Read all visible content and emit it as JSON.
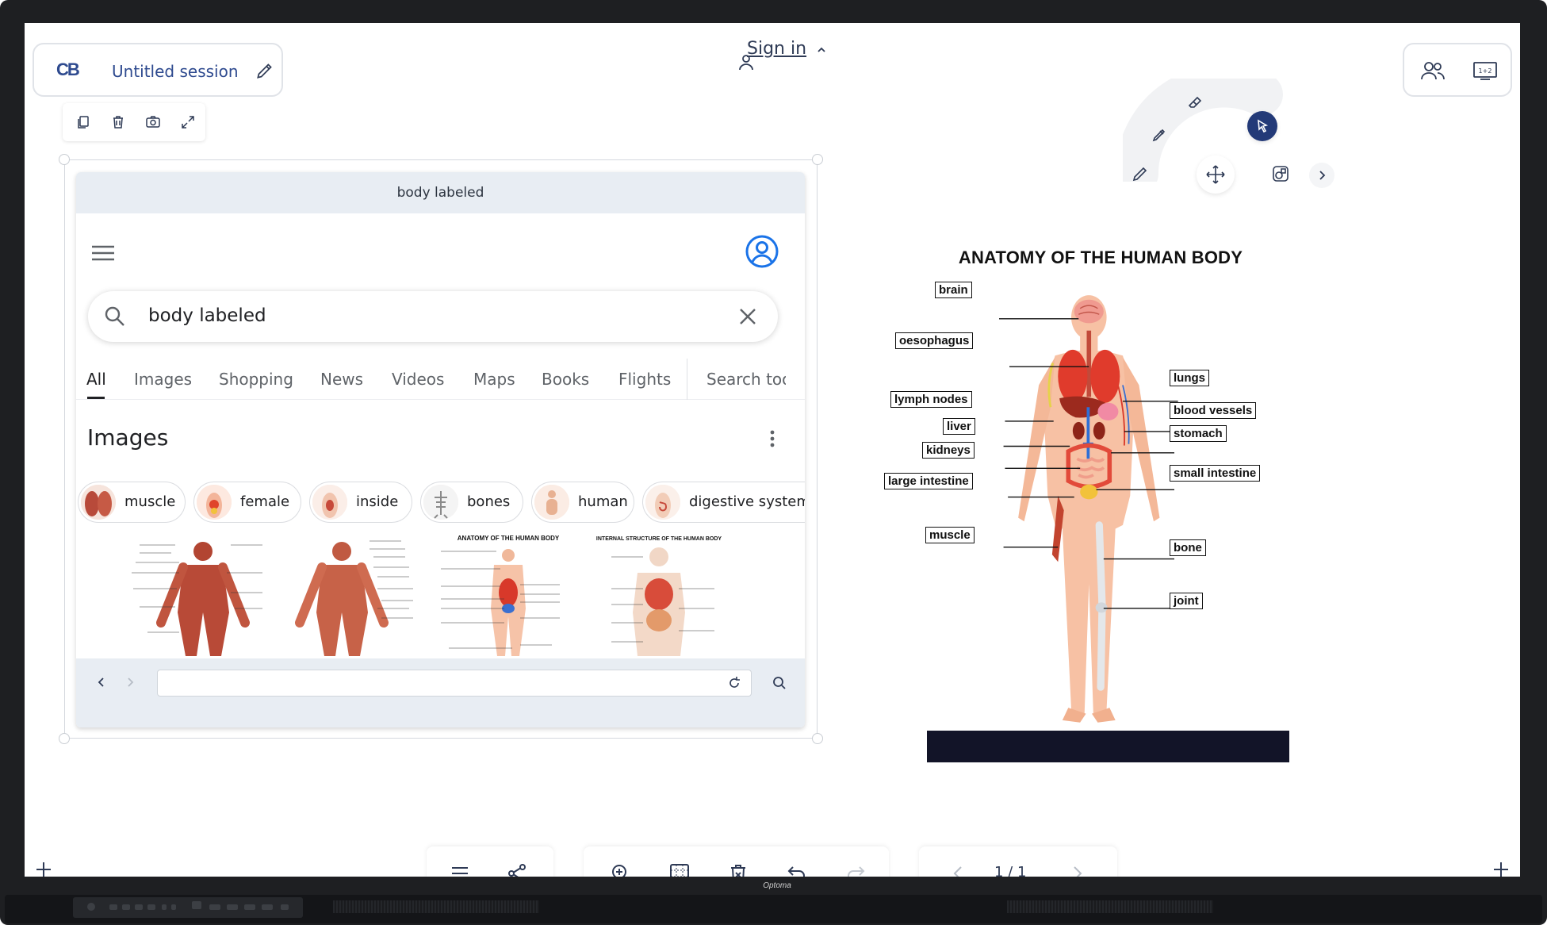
{
  "session": {
    "logo": "CB",
    "title": "Untitled session"
  },
  "account": {
    "sign_in_label": "Sign in"
  },
  "browser": {
    "window_title": "body labeled",
    "search_query": "body labeled",
    "tabs": [
      {
        "label": "All",
        "active": true
      },
      {
        "label": "Images"
      },
      {
        "label": "Shopping"
      },
      {
        "label": "News"
      },
      {
        "label": "Videos"
      },
      {
        "label": "Maps"
      },
      {
        "label": "Books"
      },
      {
        "label": "Flights"
      },
      {
        "label": "Search too"
      }
    ],
    "images_heading": "Images",
    "chips": [
      {
        "label": "muscle"
      },
      {
        "label": "female"
      },
      {
        "label": "inside"
      },
      {
        "label": "bones"
      },
      {
        "label": "human"
      },
      {
        "label": "digestive system"
      }
    ],
    "thumb_titles": {
      "anatomy": "ANATOMY OF THE HUMAN BODY",
      "internal": "INTERNAL STRUCTURE OF THE HUMAN BODY"
    },
    "url_value": ""
  },
  "poster": {
    "title": "ANATOMY OF THE HUMAN BODY",
    "labels_left": [
      "brain",
      "oesophagus",
      "lymph nodes",
      "liver",
      "kidneys",
      "large intestine",
      "muscle"
    ],
    "labels_right": [
      "lungs",
      "blood vessels",
      "stomach",
      "small intestine",
      "bone",
      "joint"
    ]
  },
  "pager": {
    "page_indicator": "1 / 1"
  },
  "display": {
    "brand": "Optoma"
  },
  "colors": {
    "accent": "#233a78",
    "brand_blue": "#2e4a8f",
    "google_blue": "#1a73e8"
  }
}
